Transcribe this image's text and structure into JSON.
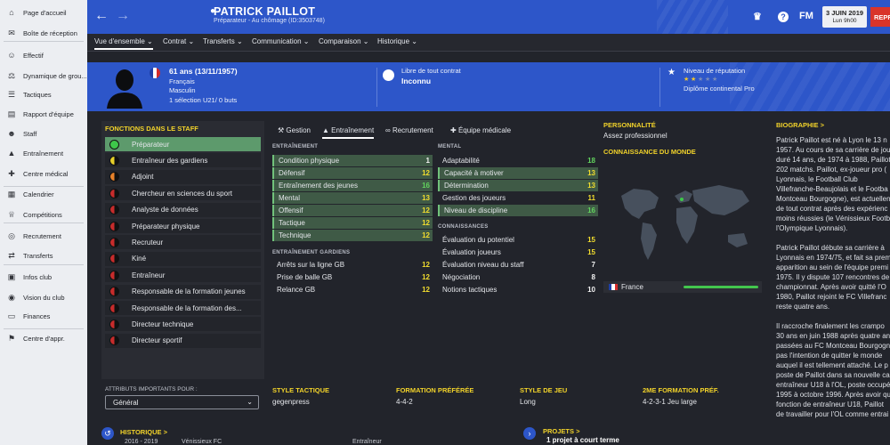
{
  "sidebar": {
    "items": [
      {
        "label": "Page d'accueil",
        "icon": "home-icon"
      },
      {
        "label": "Boîte de réception",
        "icon": "inbox-icon"
      },
      {
        "label": "Effectif",
        "icon": "squad-icon"
      },
      {
        "label": "Dynamique de grou...",
        "icon": "dynamics-icon"
      },
      {
        "label": "Tactiques",
        "icon": "tactics-icon"
      },
      {
        "label": "Rapport d'équipe",
        "icon": "report-icon"
      },
      {
        "label": "Staff",
        "icon": "staff-icon"
      },
      {
        "label": "Entraînement",
        "icon": "training-icon"
      },
      {
        "label": "Centre médical",
        "icon": "medical-icon"
      },
      {
        "label": "Calendrier",
        "icon": "calendar-icon"
      },
      {
        "label": "Compétitions",
        "icon": "trophy-icon"
      },
      {
        "label": "Recrutement",
        "icon": "scouting-icon"
      },
      {
        "label": "Transferts",
        "icon": "transfers-icon"
      },
      {
        "label": "Infos club",
        "icon": "club-info-icon"
      },
      {
        "label": "Vision du club",
        "icon": "vision-icon"
      },
      {
        "label": "Finances",
        "icon": "finances-icon"
      },
      {
        "label": "Centre d'appr.",
        "icon": "academy-icon"
      }
    ]
  },
  "header": {
    "title": "PATRICK PAILLOT",
    "subtitle": "Préparateur - Au chômage (ID:3503748)",
    "fm_label": "FM",
    "date": "3 JUIN 2019",
    "time": "Lun 9h00",
    "resume_label": "REPR",
    "accent": "#2d56c9"
  },
  "tabs": [
    "Vue d'ensemble",
    "Contrat",
    "Transferts",
    "Communication",
    "Comparaison",
    "Historique"
  ],
  "profile": {
    "age": "61 ans (13/11/1957)",
    "nationality": "Français",
    "gender": "Masculin",
    "caps": "1 sélection U21/ 0 buts",
    "contract_label": "Libre de tout contrat",
    "contract_value": "Inconnu",
    "reputation_label": "Niveau de réputation",
    "reputation_stars": 2,
    "reputation_max": 5,
    "diploma": "Diplôme continental Pro"
  },
  "roles_panel": {
    "title": "FONCTIONS DANS LE STAFF",
    "roles": [
      {
        "label": "Préparateur",
        "selected": true,
        "color": "#3ec84a"
      },
      {
        "label": "Entraîneur des gardiens",
        "selected": false,
        "color": "#e6cf2a"
      },
      {
        "label": "Adjoint",
        "selected": false,
        "color": "#e8822a"
      },
      {
        "label": "Chercheur en sciences du sport",
        "selected": false,
        "color": "#c72c2c"
      },
      {
        "label": "Analyste de données",
        "selected": false,
        "color": "#c72c2c"
      },
      {
        "label": "Préparateur physique",
        "selected": false,
        "color": "#c72c2c"
      },
      {
        "label": "Recruteur",
        "selected": false,
        "color": "#c72c2c"
      },
      {
        "label": "Kiné",
        "selected": false,
        "color": "#c72c2c"
      },
      {
        "label": "Entraîneur",
        "selected": false,
        "color": "#c72c2c"
      },
      {
        "label": "Responsable de la formation jeunes",
        "selected": false,
        "color": "#c72c2c"
      },
      {
        "label": "Responsable de la formation des...",
        "selected": false,
        "color": "#c72c2c"
      },
      {
        "label": "Directeur technique",
        "selected": false,
        "color": "#c72c2c"
      },
      {
        "label": "Directeur sportif",
        "selected": false,
        "color": "#c72c2c"
      }
    ],
    "important_label": "ATTRIBUTS IMPORTANTS POUR :",
    "select_value": "Général"
  },
  "attr_tabs": [
    "Gestion",
    "Entraînement",
    "Recrutement",
    "Équipe médicale"
  ],
  "attributes": {
    "training_title": "ENTRAÎNEMENT",
    "training": [
      {
        "label": "Condition physique",
        "value": "1",
        "hl": true,
        "c": "w"
      },
      {
        "label": "Défensif",
        "value": "12",
        "hl": true,
        "c": "y"
      },
      {
        "label": "Entraînement des jeunes",
        "value": "16",
        "hl": true,
        "c": "g"
      },
      {
        "label": "Mental",
        "value": "13",
        "hl": true,
        "c": "y"
      },
      {
        "label": "Offensif",
        "value": "12",
        "hl": true,
        "c": "y"
      },
      {
        "label": "Tactique",
        "value": "12",
        "hl": true,
        "c": "y"
      },
      {
        "label": "Technique",
        "value": "12",
        "hl": true,
        "c": "y"
      }
    ],
    "gk_title": "ENTRAÎNEMENT GARDIENS",
    "gk": [
      {
        "label": "Arrêts sur la ligne GB",
        "value": "12",
        "hl": false,
        "c": "y"
      },
      {
        "label": "Prise de balle GB",
        "value": "12",
        "hl": false,
        "c": "y"
      },
      {
        "label": "Relance GB",
        "value": "12",
        "hl": false,
        "c": "y"
      }
    ],
    "mental_title": "MENTAL",
    "mental": [
      {
        "label": "Adaptabilité",
        "value": "18",
        "hl": false,
        "c": "g"
      },
      {
        "label": "Capacité à motiver",
        "value": "13",
        "hl": true,
        "c": "y"
      },
      {
        "label": "Détermination",
        "value": "13",
        "hl": true,
        "c": "y"
      },
      {
        "label": "Gestion des joueurs",
        "value": "11",
        "hl": false,
        "c": "y"
      },
      {
        "label": "Niveau de discipline",
        "value": "16",
        "hl": true,
        "c": "g"
      }
    ],
    "know_title": "CONNAISSANCES",
    "know": [
      {
        "label": "Évaluation du potentiel",
        "value": "15",
        "hl": false,
        "c": "y"
      },
      {
        "label": "Évaluation joueurs",
        "value": "15",
        "hl": false,
        "c": "y"
      },
      {
        "label": "Évaluation niveau du staff",
        "value": "7",
        "hl": false,
        "c": "w"
      },
      {
        "label": "Négociation",
        "value": "8",
        "hl": false,
        "c": "w"
      },
      {
        "label": "Notions tactiques",
        "value": "10",
        "hl": false,
        "c": "w"
      }
    ]
  },
  "personality": {
    "title": "PERSONNALITÉ",
    "value": "Assez professionnel",
    "world_title": "CONNAISSANCE DU MONDE",
    "country": "France",
    "country_knowledge": 1.0
  },
  "bio": {
    "title": "BIOGRAPHIE >",
    "lines": [
      "Patrick Paillot est né à Lyon le 13 n",
      "1957. Au cours de sa carrière de jou",
      "duré 14 ans, de 1974 à 1988, Paillot",
      "202 matchs. Paillot, ex-joueur pro (",
      "Lyonnais, le Football Club",
      "Villefranche-Beaujolais et le Footba",
      "Montceau Bourgogne), est actuellen",
      "de tout contrat après des expérienc",
      "moins réussies (le Vénissieux Footb",
      "l'Olympique Lyonnais).",
      "",
      "Patrick Paillot débute sa carrière à",
      "Lyonnais en 1974/75, et fait sa prem",
      "apparition au sein de l'équipe premi",
      "1975. Il y dispute 107 rencontres de",
      "championnat. Après avoir quitté l'O",
      "1980, Paillot rejoint le FC Villefranc",
      "reste quatre ans.",
      "",
      "Il raccroche finalement les crampo",
      "30 ans en juin 1988 après quatre an",
      "passées au FC Montceau Bourgogn",
      "pas l'intention de quitter le monde",
      "auquel il est tellement attaché. Le p",
      "poste de Paillot dans sa nouvelle ca",
      "entraîneur U18 à l'OL, poste occupé",
      "1995 à octobre 1996. Après avoir qu",
      "fonction de entraîneur U18, Paillot",
      "de travailler pour l'OL comme entrai"
    ]
  },
  "tactics": [
    {
      "label": "STYLE TACTIQUE",
      "value": "gegenpress"
    },
    {
      "label": "FORMATION PRÉFÉRÉE",
      "value": "4-4-2"
    },
    {
      "label": "STYLE DE JEU",
      "value": "Long"
    },
    {
      "label": "2ME FORMATION PRÉF.",
      "value": "4-2-3-1 Jeu large"
    }
  ],
  "history": {
    "title": "HISTORIQUE >",
    "row": {
      "season": "2016 - 2019",
      "club": "Vénissieux FC",
      "role": "Entraîneur"
    }
  },
  "projects": {
    "title": "PROJETS >",
    "value": "1 projet à court terme"
  }
}
